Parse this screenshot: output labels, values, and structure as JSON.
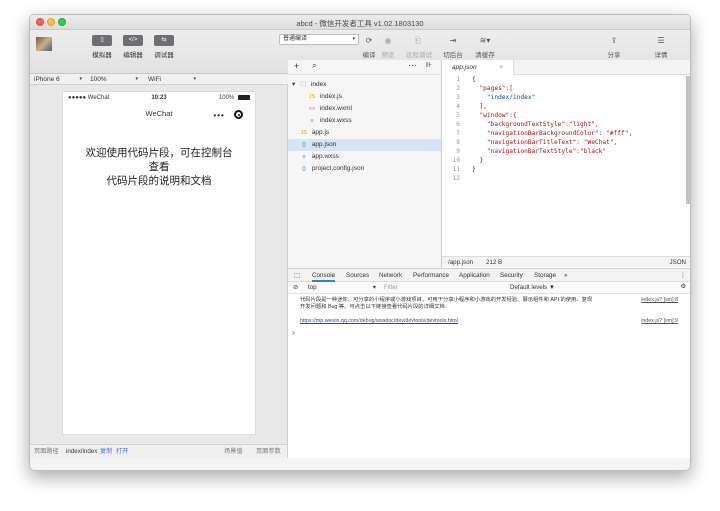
{
  "window": {
    "title": "abcd - 微信开发者工具 v1.02.1803130"
  },
  "toolbar": {
    "simulator_label": "模拟器",
    "editor_label": "编辑器",
    "debugger_label": "调试器",
    "compile_mode": "普通编译",
    "compile_label": "编译",
    "preview_label": "预览",
    "remote_debug_label": "远程调试",
    "background_label": "切后台",
    "clear_cache_label": "清缓存",
    "share_label": "分享",
    "details_label": "详情"
  },
  "device_bar": {
    "device": "iPhone 6",
    "zoom": "100%",
    "network": "WiFi"
  },
  "phone": {
    "carrier": "●●●●● WeChat",
    "time": "10:23",
    "battery": "100%",
    "nav_title": "WeChat",
    "capsule_dots": "•••",
    "content_line1": "欢迎使用代码片段，可在控制台查看",
    "content_line2": "代码片段的说明和文档"
  },
  "sim_bottom": {
    "path_label": "页面路径",
    "path_value": "index/index",
    "copy_label": "复制",
    "open_label": "打开",
    "scene_label": "场景值",
    "params_label": "页面参数"
  },
  "file_tree": {
    "items": [
      {
        "name": "index",
        "icon": "folder-icon"
      },
      {
        "name": "index.js",
        "icon": "js-icon"
      },
      {
        "name": "index.wxml",
        "icon": "wxml-icon"
      },
      {
        "name": "index.wxss",
        "icon": "wxss-icon"
      },
      {
        "name": "app.js",
        "icon": "js-icon"
      },
      {
        "name": "app.json",
        "icon": "json-icon"
      },
      {
        "name": "app.wxss",
        "icon": "wxss-icon"
      },
      {
        "name": "project.config.json",
        "icon": "json-icon"
      }
    ]
  },
  "editor": {
    "tab_label": "app.json",
    "lines": [
      "{",
      "  \"pages\":[",
      "    \"index/index\"",
      "  ],",
      "  \"window\":{",
      "    \"backgroundTextStyle\":\"light\",",
      "    \"navigationBarBackgroundColor\": \"#fff\",",
      "    \"navigationBarTitleText\": \"WeChat\",",
      "    \"navigationBarTextStyle\":\"black\"",
      "  }",
      "}",
      ""
    ],
    "status_path": "/app.json",
    "status_size": "212 B",
    "status_lang": "JSON"
  },
  "console": {
    "tabs": [
      "Console",
      "Sources",
      "Network",
      "Performance",
      "Application",
      "Security",
      "Storage",
      "»"
    ],
    "context": "top",
    "filter_placeholder": "Filter",
    "levels": "Default levels ▼",
    "message_line1": "代码片段是一种迷你、可分享的小程序或小游戏项目，可用于分享小程序和小游戏的开发经验、展示组件和 API 的使用、复现",
    "message_line2": "开发问题和 Bug 等。可点击以下链接查看代码片段的详细文档：",
    "message_source1": "index.js? [sm]:8",
    "link": "https://mp.weixin.qq.com/debug/wxadoc/dev/devtools/devtools.html",
    "message_source2": "index.js? [sm]:9",
    "prompt": "›"
  }
}
